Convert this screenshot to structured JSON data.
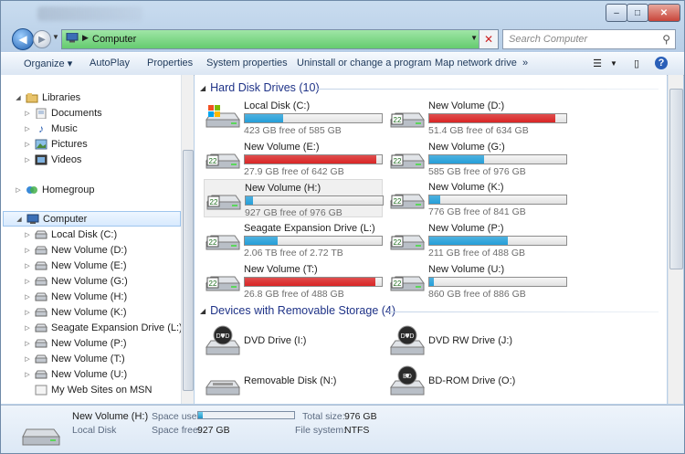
{
  "window": {
    "buttons": {
      "minimize": "–",
      "maximize": "□",
      "close": "✕"
    }
  },
  "address": {
    "path": "Computer",
    "search_placeholder": "Search Computer"
  },
  "toolbar": {
    "organize": "Organize ▾",
    "autoplay": "AutoPlay",
    "properties": "Properties",
    "system_properties": "System properties",
    "uninstall": "Uninstall or change a program",
    "map_drive": "Map network drive",
    "more": "»"
  },
  "nav": {
    "libraries": "Libraries",
    "library_items": [
      "Documents",
      "Music",
      "Pictures",
      "Videos"
    ],
    "homegroup": "Homegroup",
    "computer": "Computer",
    "computer_items": [
      "Local Disk (C:)",
      "New Volume (D:)",
      "New Volume (E:)",
      "New Volume (G:)",
      "New Volume (H:)",
      "New Volume (K:)",
      "Seagate Expansion Drive (L:)",
      "New Volume (P:)",
      "New Volume (T:)",
      "New Volume (U:)",
      "My Web Sites on MSN"
    ]
  },
  "content": {
    "hdd_header": "Hard Disk Drives (10)",
    "removable_header": "Devices with Removable Storage (4)",
    "drives": [
      {
        "name": "Local Disk (C:)",
        "free": "423 GB free of 585 GB",
        "used_fraction": 0.28,
        "status": "normal",
        "win": true
      },
      {
        "name": "New Volume (D:)",
        "free": "51.4 GB free of 634 GB",
        "used_fraction": 0.92,
        "status": "critical",
        "win": false
      },
      {
        "name": "New Volume (E:)",
        "free": "27.9 GB free of 642 GB",
        "used_fraction": 0.96,
        "status": "critical",
        "win": false
      },
      {
        "name": "New Volume (G:)",
        "free": "585 GB free of 976 GB",
        "used_fraction": 0.4,
        "status": "normal",
        "win": false
      },
      {
        "name": "New Volume (H:)",
        "free": "927 GB free of 976 GB",
        "used_fraction": 0.05,
        "status": "normal",
        "win": false
      },
      {
        "name": "New Volume (K:)",
        "free": "776 GB free of 841 GB",
        "used_fraction": 0.08,
        "status": "normal",
        "win": false
      },
      {
        "name": "Seagate Expansion Drive (L:)",
        "free": "2.06 TB free of 2.72 TB",
        "used_fraction": 0.24,
        "status": "normal",
        "win": false
      },
      {
        "name": "New Volume (P:)",
        "free": "211 GB free of 488 GB",
        "used_fraction": 0.57,
        "status": "normal",
        "win": false
      },
      {
        "name": "New Volume (T:)",
        "free": "26.8 GB free of 488 GB",
        "used_fraction": 0.95,
        "status": "critical",
        "win": false
      },
      {
        "name": "New Volume (U:)",
        "free": "860 GB free of 886 GB",
        "used_fraction": 0.03,
        "status": "normal",
        "win": false
      }
    ],
    "removable": [
      {
        "name": "DVD Drive (I:)",
        "label": "DVD"
      },
      {
        "name": "DVD RW Drive (J:)",
        "label": "DVD"
      },
      {
        "name": "Removable Disk (N:)",
        "label": ""
      },
      {
        "name": "BD-ROM Drive (O:)",
        "label": "BD"
      }
    ]
  },
  "details": {
    "name": "New Volume (H:)",
    "type": "Local Disk",
    "space_used_label": "Space used:",
    "space_free_label": "Space free:",
    "space_free": "927 GB",
    "total_size_label": "Total size:",
    "total_size": "976 GB",
    "file_system_label": "File system:",
    "file_system": "NTFS",
    "used_fraction": 0.05
  },
  "colors": {
    "bar_normal": "#26a0da",
    "bar_critical": "#da2626"
  }
}
